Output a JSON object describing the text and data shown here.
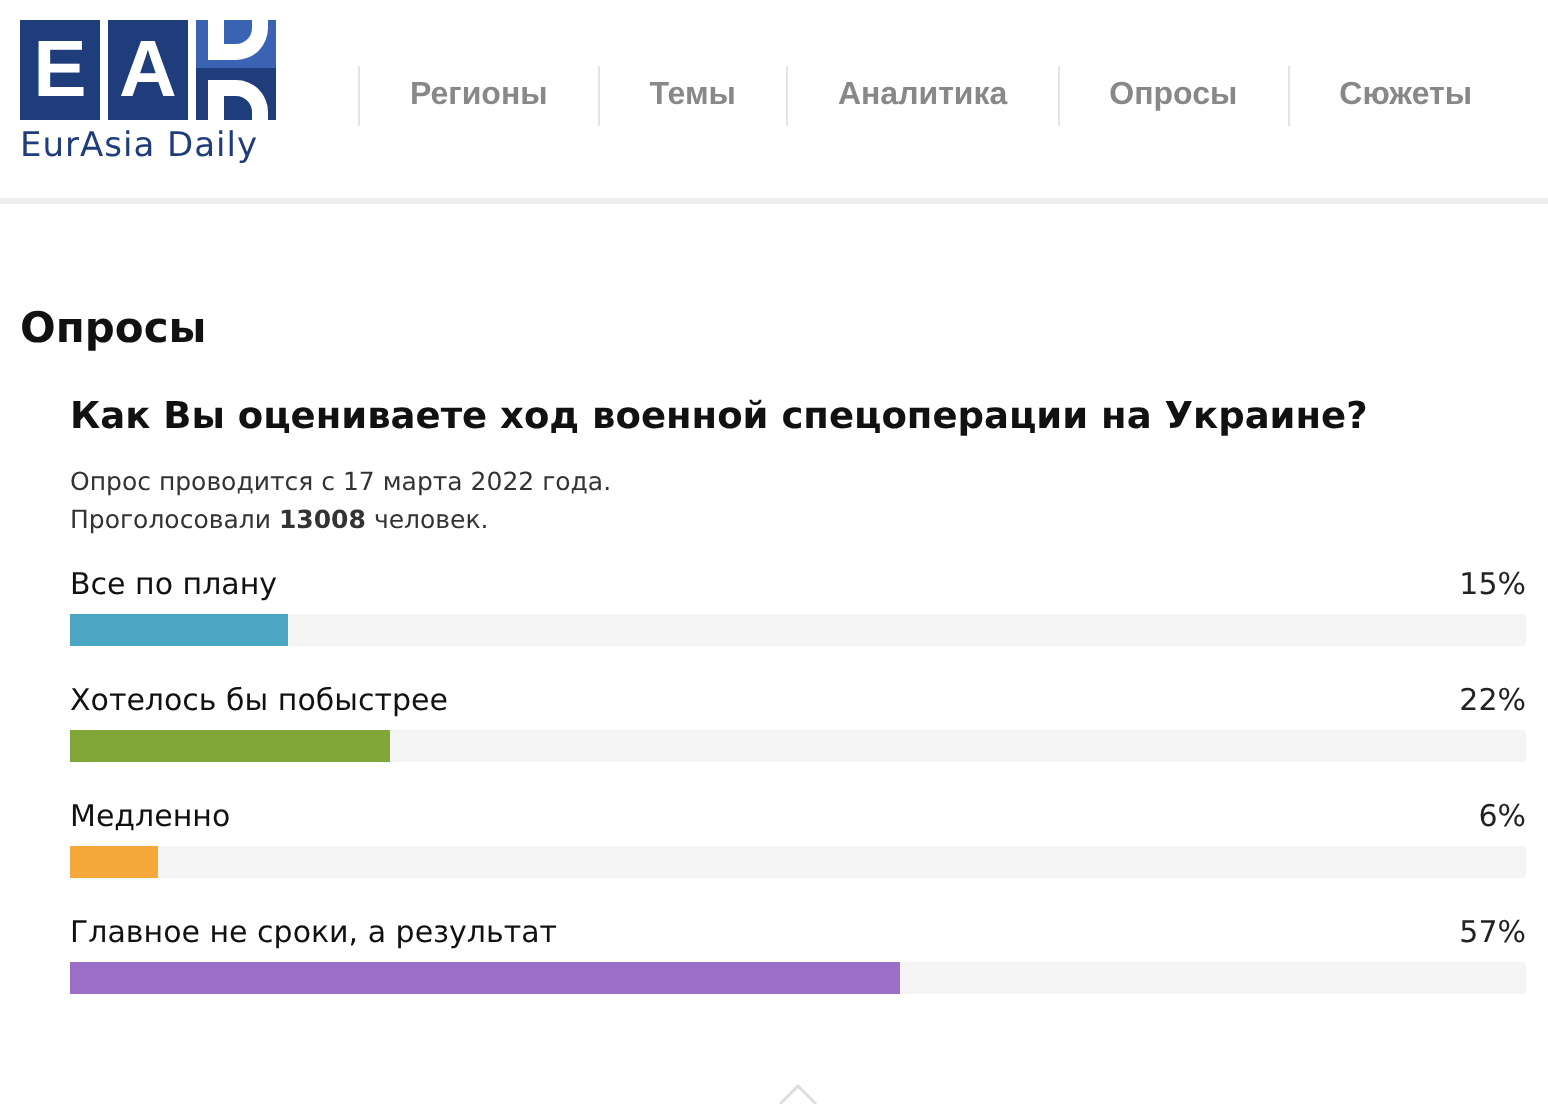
{
  "logo": {
    "letters": [
      "E",
      "A"
    ],
    "caption": "EurAsia Daily"
  },
  "nav": [
    "Регионы",
    "Темы",
    "Аналитика",
    "Опросы",
    "Сюжеты"
  ],
  "section_title": "Опросы",
  "poll": {
    "question": "Как Вы оцениваете ход военной спецоперации на Украине?",
    "info": [
      "Опрос проводится с 17 марта 2022 года.",
      "Проголосовали **13008** человек."
    ],
    "options": [
      {
        "label": "Все по плану",
        "percent": "15%",
        "level": 0.15,
        "color": "#4aa6c2"
      },
      {
        "label": "Хотелось бы побыстрее",
        "percent": "22%",
        "level": 0.22,
        "color": "#7fa636"
      },
      {
        "label": "Медленно",
        "percent": "6%",
        "level": 0.06,
        "color": "#f6a93b"
      },
      {
        "label": "Главное не сроки, а результат",
        "percent": "57%",
        "level": 0.57,
        "color": "#9b6fc6"
      }
    ]
  }
}
